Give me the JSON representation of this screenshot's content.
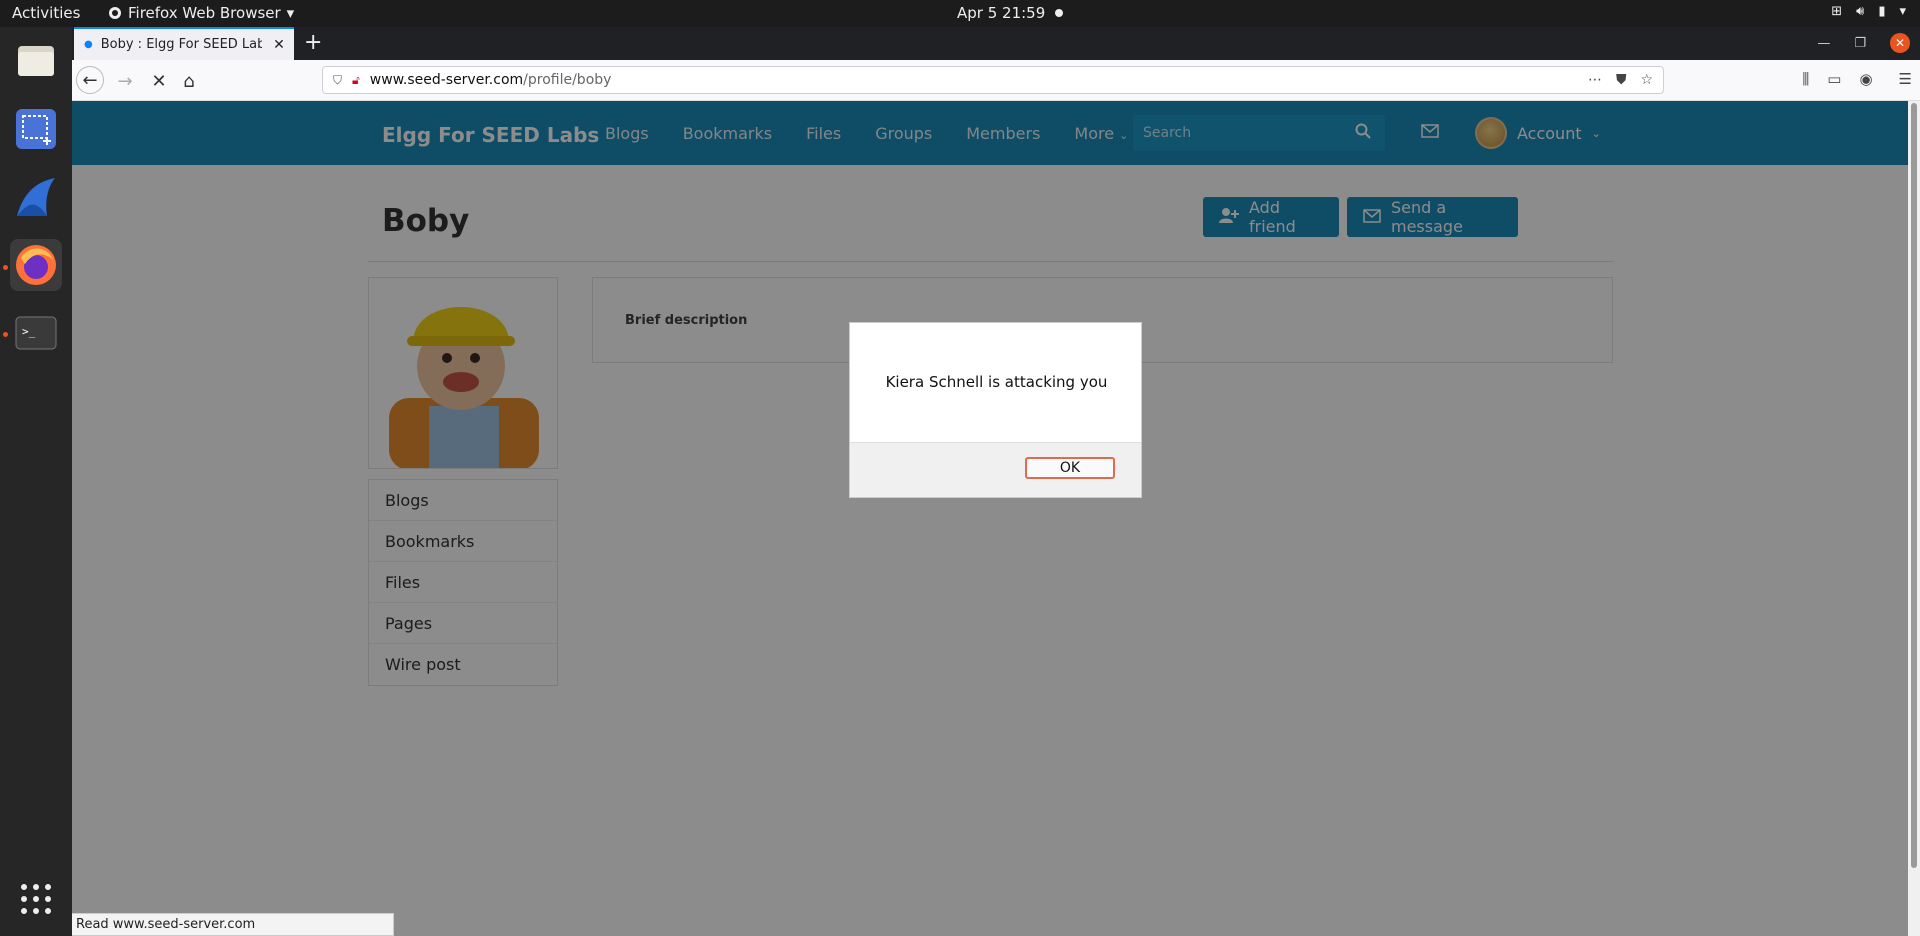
{
  "topbar": {
    "activities": "Activities",
    "app_name": "Firefox Web Browser",
    "clock": "Apr 5  21:59"
  },
  "dock": {
    "items": [
      "files-icon",
      "screenshot-icon",
      "wireshark-icon",
      "firefox-icon",
      "terminal-icon",
      "app-grid-icon"
    ]
  },
  "browser": {
    "tab_title": "Boby : Elgg For SEED Lab",
    "url_host": "www.seed-server.com",
    "url_path": "/profile/boby",
    "status_text": "Read www.seed-server.com"
  },
  "site": {
    "brand": "Elgg For SEED Labs",
    "menu": [
      "Blogs",
      "Bookmarks",
      "Files",
      "Groups",
      "Members",
      "More"
    ],
    "search_placeholder": "Search",
    "account_label": "Account"
  },
  "profile": {
    "name": "Boby",
    "add_friend_label": "Add friend",
    "send_message_label": "Send a message",
    "owner_menu": [
      "Blogs",
      "Bookmarks",
      "Files",
      "Pages",
      "Wire post"
    ],
    "brief_description_label": "Brief description"
  },
  "alert": {
    "message": "Kiera Schnell is attacking you",
    "ok_label": "OK"
  },
  "colors": {
    "elgg_blue": "#1d8bb8",
    "ubuntu_orange": "#e95420"
  }
}
